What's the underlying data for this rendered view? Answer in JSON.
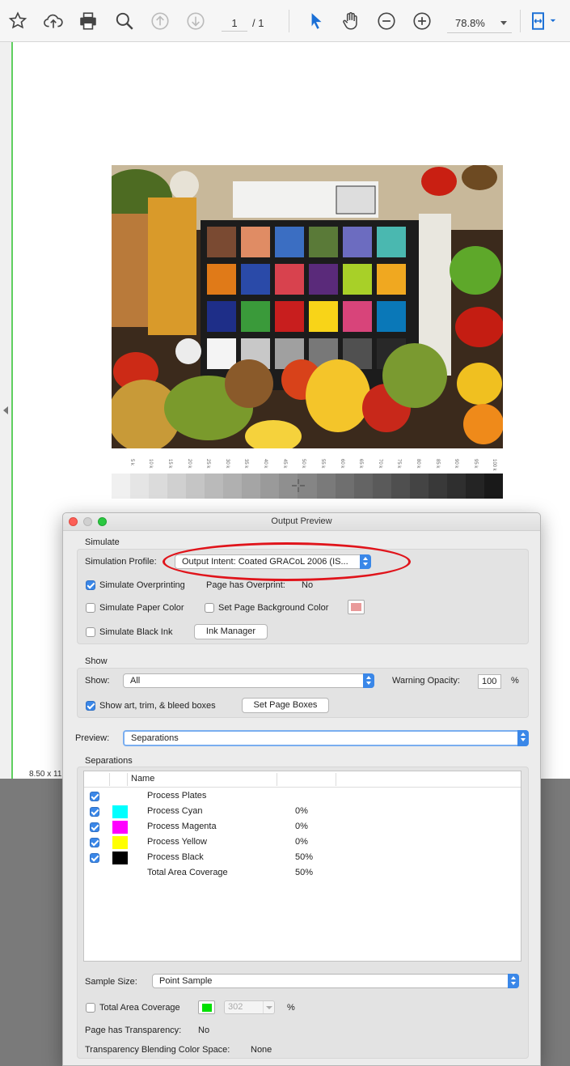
{
  "toolbar": {
    "icons": [
      "star-icon",
      "cloud-upload-icon",
      "printer-icon",
      "magnifier-icon",
      "arrow-up-circle-icon",
      "arrow-down-circle-icon",
      "select-arrow-icon",
      "hand-icon",
      "zoom-out-icon",
      "zoom-in-icon",
      "page-fit-icon"
    ],
    "page_current": "1",
    "page_total": "/ 1",
    "zoom": "78.8%",
    "accent_color": "#1a6fd6"
  },
  "document": {
    "page_size": "8.50 x 11",
    "scale_labels": [
      "5 k",
      "10 k",
      "15 k",
      "20 k",
      "25 k",
      "30 k",
      "35 k",
      "40 k",
      "45 k",
      "50 k",
      "55 k",
      "60 k",
      "65 k",
      "70 k",
      "75 k",
      "80 k",
      "85 k",
      "90 k",
      "95 k",
      "100 k"
    ]
  },
  "dialog": {
    "title": "Output Preview",
    "simulate": {
      "group_label": "Simulate",
      "profile_label": "Simulation Profile:",
      "profile_value": "Output Intent: Coated GRACoL 2006 (IS...",
      "overprinting_label": "Simulate Overprinting",
      "overprinting_checked": true,
      "page_overprint_label": "Page has Overprint:",
      "page_overprint_value": "No",
      "paper_color_label": "Simulate Paper Color",
      "page_bg_label": "Set Page Background Color",
      "page_bg_swatch": "#e99a9a",
      "black_ink_label": "Simulate Black Ink",
      "ink_manager_label": "Ink Manager"
    },
    "show": {
      "group_label": "Show",
      "show_label": "Show:",
      "show_value": "All",
      "warning_opacity_label": "Warning Opacity:",
      "warning_opacity_value": "100",
      "percent": "%",
      "boxes_label": "Show art, trim, & bleed boxes",
      "boxes_checked": true,
      "set_page_boxes_label": "Set Page Boxes"
    },
    "preview": {
      "label": "Preview:",
      "value": "Separations"
    },
    "separations": {
      "group_label": "Separations",
      "column_name": "Name",
      "rows": [
        {
          "checked": true,
          "swatch": "",
          "name": "Process Plates",
          "percent": ""
        },
        {
          "checked": true,
          "swatch": "#00ffff",
          "name": "Process Cyan",
          "percent": "0%"
        },
        {
          "checked": true,
          "swatch": "#ff00ff",
          "name": "Process Magenta",
          "percent": "0%"
        },
        {
          "checked": true,
          "swatch": "#ffff00",
          "name": "Process Yellow",
          "percent": "0%"
        },
        {
          "checked": true,
          "swatch": "#000000",
          "name": "Process Black",
          "percent": "50%"
        },
        {
          "checked": false,
          "swatch": "",
          "name": "Total Area Coverage",
          "percent": "50%",
          "no_checkbox": true
        }
      ]
    },
    "sample_size_label": "Sample Size:",
    "sample_size_value": "Point Sample",
    "tac_label": "Total Area Coverage",
    "tac_swatch": "#00e000",
    "tac_value": "302",
    "tac_percent": "%",
    "transparency_label": "Page has Transparency:",
    "transparency_value": "No",
    "blending_label": "Transparency Blending Color Space:",
    "blending_value": "None"
  }
}
